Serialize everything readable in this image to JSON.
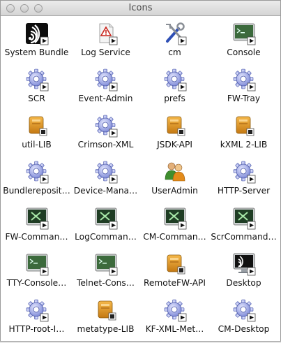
{
  "window": {
    "title": "Icons"
  },
  "items": [
    {
      "label": "System Bundle",
      "icon": "system-bundle-icon"
    },
    {
      "label": "Log Service",
      "icon": "log-service-icon"
    },
    {
      "label": "cm",
      "icon": "tools-icon"
    },
    {
      "label": "Console",
      "icon": "console-icon"
    },
    {
      "label": "SCR",
      "icon": "gear-icon"
    },
    {
      "label": "Event-Admin",
      "icon": "gear-icon"
    },
    {
      "label": "prefs",
      "icon": "gear-icon"
    },
    {
      "label": "FW-Tray",
      "icon": "gear-icon"
    },
    {
      "label": "util-LIB",
      "icon": "library-icon"
    },
    {
      "label": "Crimson-XML",
      "icon": "gear-icon"
    },
    {
      "label": "JSDK-API",
      "icon": "library-icon"
    },
    {
      "label": "kXML 2-LIB",
      "icon": "library-icon"
    },
    {
      "label": "Bundlereposit…",
      "icon": "gear-icon"
    },
    {
      "label": "Device-Mana…",
      "icon": "gear-icon"
    },
    {
      "label": "UserAdmin",
      "icon": "users-icon"
    },
    {
      "label": "HTTP-Server",
      "icon": "gear-icon"
    },
    {
      "label": "FW-Comman…",
      "icon": "command-icon"
    },
    {
      "label": "LogComman…",
      "icon": "command-icon"
    },
    {
      "label": "CM-Comman…",
      "icon": "command-icon"
    },
    {
      "label": "ScrCommand…",
      "icon": "command-icon"
    },
    {
      "label": "TTY-Console…",
      "icon": "console-icon"
    },
    {
      "label": "Telnet-Cons…",
      "icon": "console-icon"
    },
    {
      "label": "RemoteFW-API",
      "icon": "library-icon"
    },
    {
      "label": "Desktop",
      "icon": "desktop-icon"
    },
    {
      "label": "HTTP-root-I…",
      "icon": "gear-icon"
    },
    {
      "label": "metatype-LIB",
      "icon": "library-icon"
    },
    {
      "label": "KF-XML-Met…",
      "icon": "gear-icon"
    },
    {
      "label": "CM-Desktop",
      "icon": "gear-icon"
    }
  ]
}
